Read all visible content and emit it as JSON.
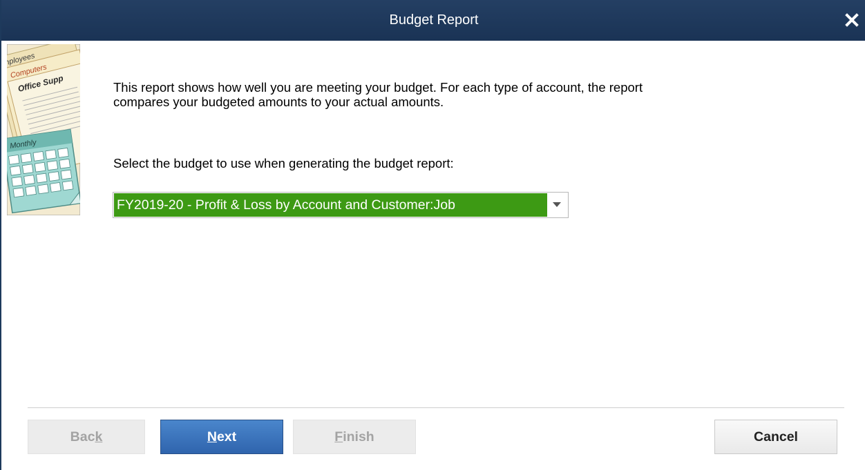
{
  "window": {
    "title": "Budget Report"
  },
  "icons": {
    "close": "close-icon",
    "side_art": "budget-illustration",
    "dropdown": "chevron-down-icon"
  },
  "side_art": {
    "tab_employees": "mployees",
    "tab_computers": "Computers",
    "office_supplies": "Office Supp",
    "calendar_label": "Monthly"
  },
  "content": {
    "description": "This report shows how well you are meeting your budget.  For each type of account, the report compares your budgeted amounts to your actual amounts.",
    "select_prompt": "Select the budget to use when generating the budget report:",
    "budget_selected": "FY2019-20 - Profit & Loss by Account and Customer:Job"
  },
  "buttons": {
    "back": {
      "pre": "Bac",
      "key": "k",
      "post": ""
    },
    "next": {
      "pre": "",
      "key": "N",
      "post": "ext"
    },
    "finish": {
      "pre": "",
      "key": "F",
      "post": "inish"
    },
    "cancel": "Cancel"
  },
  "colors": {
    "titlebar": "#1f3a5f",
    "selection": "#3d9a14",
    "primary_button": "#3a72bd"
  }
}
